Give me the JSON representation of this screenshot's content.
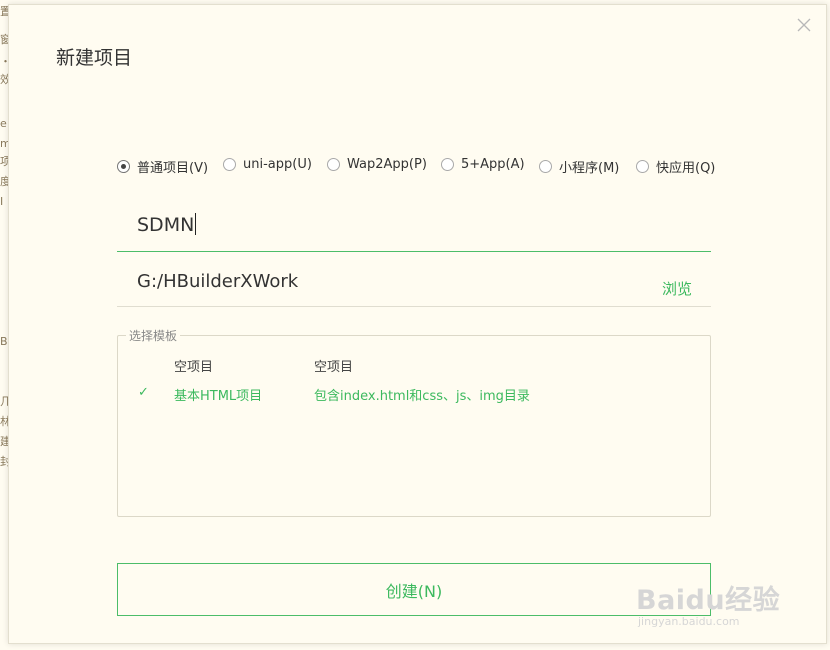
{
  "background_text": [
    "置",
    "窗",
    "・",
    "效",
    "e",
    "m",
    "项",
    "度",
    "I",
    "B",
    "几",
    "林",
    "建",
    "封"
  ],
  "dialog": {
    "title": "新建项目",
    "close_icon": "close-icon",
    "project_types": [
      {
        "label": "普通项目(V)",
        "selected": true
      },
      {
        "label": "uni-app(U)",
        "selected": false
      },
      {
        "label": "Wap2App(P)",
        "selected": false
      },
      {
        "label": "5+App(A)",
        "selected": false
      },
      {
        "label": "小程序(M)",
        "selected": false
      },
      {
        "label": "快应用(Q)",
        "selected": false
      }
    ],
    "project_name": {
      "value": "SDMN"
    },
    "project_path": {
      "value": "G:/HBuilderXWork",
      "browse_label": "浏览"
    },
    "template": {
      "legend": "选择模板",
      "rows": [
        {
          "check": "",
          "name": "空项目",
          "description": "空项目",
          "selected": false
        },
        {
          "check": "✓",
          "name": "基本HTML项目",
          "description": "包含index.html和css、js、img目录",
          "selected": true
        }
      ]
    },
    "create_button": {
      "label": "创建(N)"
    },
    "accent_color": "#3cb95e"
  },
  "watermark": {
    "main": "Baidu经验",
    "sub": "jingyan.baidu.com"
  }
}
